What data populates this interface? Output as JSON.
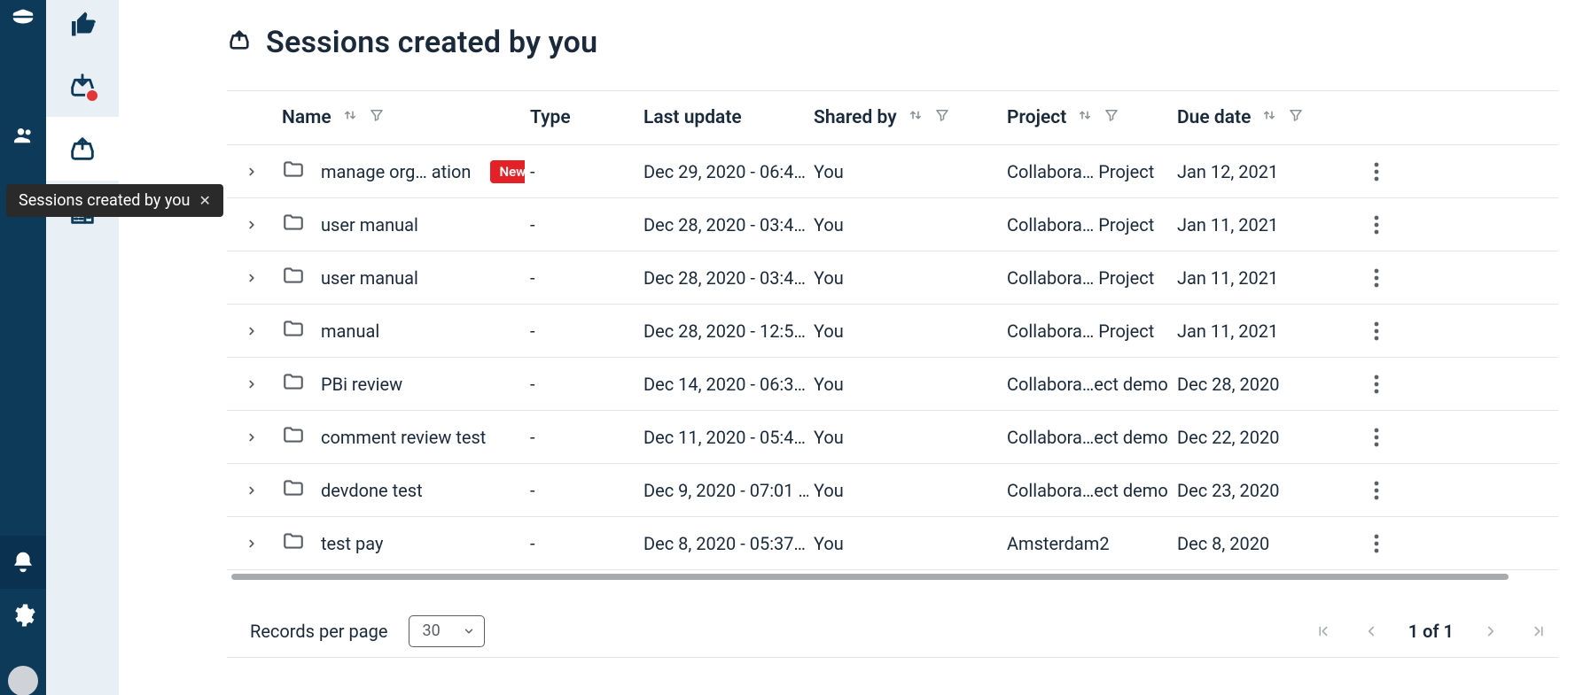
{
  "tooltip": {
    "text": "Sessions created by you"
  },
  "page": {
    "title": "Sessions created by you"
  },
  "columns": {
    "name": "Name",
    "type": "Type",
    "last_update": "Last update",
    "shared_by": "Shared by",
    "project": "Project",
    "due_date": "Due date"
  },
  "rows": [
    {
      "name": "manage org…  ation",
      "is_new": true,
      "type": "-",
      "last_update": "Dec 29, 2020 - 06:4…",
      "shared_by": "You",
      "project": "Collabora… Project",
      "due_date": "Jan 12, 2021"
    },
    {
      "name": "user manual",
      "is_new": false,
      "type": "-",
      "last_update": "Dec 28, 2020 - 03:4…",
      "shared_by": "You",
      "project": "Collabora… Project",
      "due_date": "Jan 11, 2021"
    },
    {
      "name": "user manual",
      "is_new": false,
      "type": "-",
      "last_update": "Dec 28, 2020 - 03:4…",
      "shared_by": "You",
      "project": "Collabora… Project",
      "due_date": "Jan 11, 2021"
    },
    {
      "name": "manual",
      "is_new": false,
      "type": "-",
      "last_update": "Dec 28, 2020 - 12:5…",
      "shared_by": "You",
      "project": "Collabora… Project",
      "due_date": "Jan 11, 2021"
    },
    {
      "name": "PBi review",
      "is_new": false,
      "type": "-",
      "last_update": "Dec 14, 2020 - 06:3…",
      "shared_by": "You",
      "project": "Collabora…ect demo",
      "due_date": "Dec 28, 2020"
    },
    {
      "name": "comment review test",
      "is_new": false,
      "type": "-",
      "last_update": "Dec 11, 2020 - 05:4…",
      "shared_by": "You",
      "project": "Collabora…ect demo",
      "due_date": "Dec 22, 2020"
    },
    {
      "name": "devdone test",
      "is_new": false,
      "type": "-",
      "last_update": "Dec 9, 2020 - 07:01 …",
      "shared_by": "You",
      "project": "Collabora…ect demo",
      "due_date": "Dec 23, 2020"
    },
    {
      "name": "test pay",
      "is_new": false,
      "type": "-",
      "last_update": "Dec 8, 2020 - 05:37…",
      "shared_by": "You",
      "project": "Amsterdam2",
      "due_date": "Dec 8, 2020"
    }
  ],
  "badge": {
    "new_label": "New"
  },
  "pager": {
    "rpp_label": "Records per page",
    "rpp_value": "30",
    "status": "1 of 1"
  }
}
